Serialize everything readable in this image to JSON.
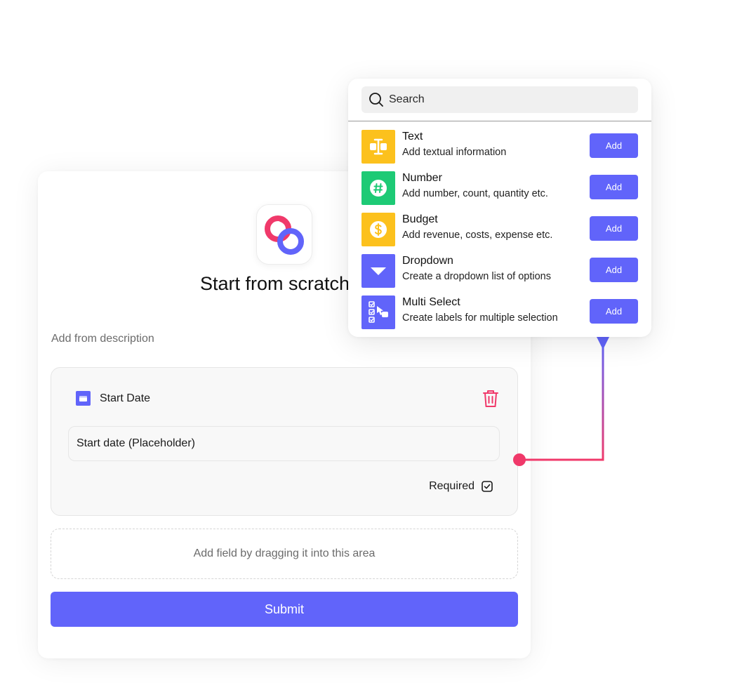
{
  "colors": {
    "accent": "#6164fa",
    "danger": "#f0396a",
    "text_yellow": "#fcc11d",
    "number_green": "#1dca75",
    "budget_yellow": "#fcc11d",
    "dropdown_purple": "#6164fa",
    "multiselect_purple": "#6164fa"
  },
  "form": {
    "title": "Start from scratch",
    "description_label": "Add from description",
    "field": {
      "name": "Start Date",
      "placeholder_value": "Start date (Placeholder)",
      "required_label": "Required",
      "required_checked": true
    },
    "drop_zone_text": "Add field by dragging it into this area",
    "submit_label": "Submit"
  },
  "picker": {
    "search_placeholder": "Search",
    "items": [
      {
        "title": "Text",
        "subtitle": "Add textual information",
        "icon": "text-cursor-icon",
        "add_label": "Add"
      },
      {
        "title": "Number",
        "subtitle": "Add number, count, quantity etc.",
        "icon": "hash-icon",
        "add_label": "Add"
      },
      {
        "title": "Budget",
        "subtitle": "Add revenue, costs, expense etc.",
        "icon": "dollar-icon",
        "add_label": "Add"
      },
      {
        "title": "Dropdown",
        "subtitle": "Create a dropdown list of options",
        "icon": "dropdown-arrow-icon",
        "add_label": "Add"
      },
      {
        "title": "Multi Select",
        "subtitle": "Create labels for multiple selection",
        "icon": "checklist-icon",
        "add_label": "Add"
      }
    ]
  }
}
